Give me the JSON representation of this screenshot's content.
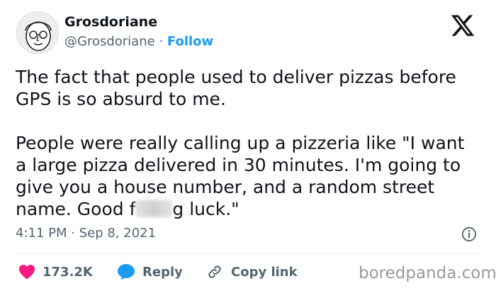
{
  "author": {
    "display_name": "Grosdoriane",
    "handle": "@Grosdoriane",
    "separator": "·",
    "follow_label": "Follow"
  },
  "tweet": {
    "line1": "The fact that people used to deliver pizzas before",
    "line2": "GPS is so absurd to me.",
    "line3": "People were really calling up a pizzeria like \"I want",
    "line4": "a large pizza delivered in 30 minutes. I'm going to",
    "line5": "give you a house number, and a random street",
    "line6_start": "name. Good f",
    "line6_end": "g luck.\""
  },
  "timestamp": "4:11 PM · Sep 8, 2021",
  "actions": {
    "like_count": "173.2K",
    "reply_label": "Reply",
    "copy_link_label": "Copy link"
  },
  "watermark": "boredpanda.com",
  "colors": {
    "accent": "#1d9bf0",
    "like": "#f91880",
    "muted": "#536471",
    "text": "#0f1419"
  },
  "icons": {
    "logo": "x-logo-icon",
    "info": "info-icon",
    "like": "heart-icon",
    "reply": "speech-bubble-icon",
    "copy": "link-icon"
  }
}
